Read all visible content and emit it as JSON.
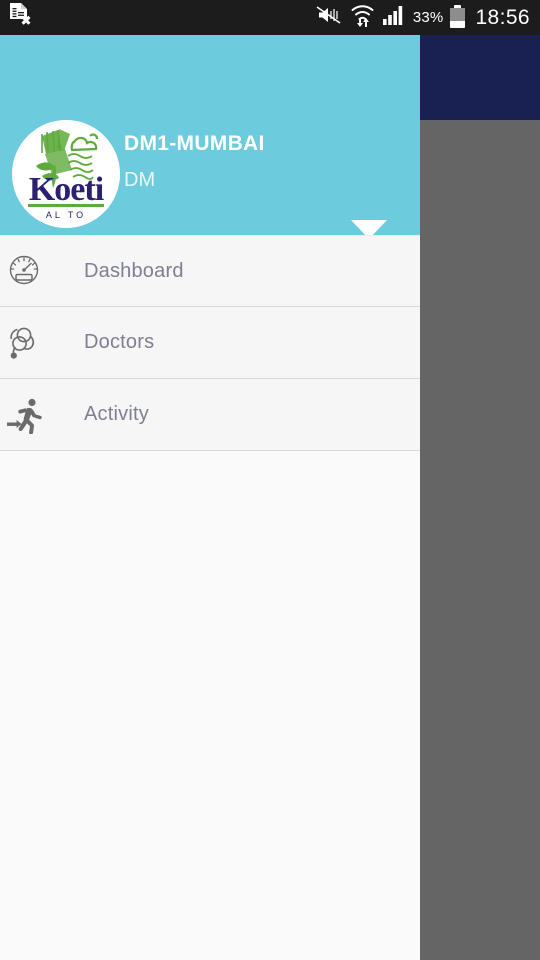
{
  "status_bar": {
    "left_icons": [
      {
        "name": "document-error-icon",
        "glyph": "document-x"
      }
    ],
    "right_icons": [
      {
        "name": "mute-icon",
        "glyph": "speaker-muted"
      },
      {
        "name": "wifi-transfer-icon",
        "glyph": "wifi-arrows"
      },
      {
        "name": "signal-icon",
        "glyph": "signal-bars"
      }
    ],
    "battery_percent": "33%",
    "clock": "18:56"
  },
  "drawer": {
    "header": {
      "title": "DM1-MUMBAI",
      "subtitle": "DM",
      "logo": {
        "name": "koeti-logo",
        "wordmark": "Koeti",
        "tagline": "AL TO",
        "emblem_color": "#5eaa3c",
        "wordmark_color": "#2a2170"
      },
      "dropdown_icon": "chevron-down-icon",
      "background_color": "#6ccbdd"
    },
    "menu_items": [
      {
        "label": "Dashboard",
        "icon": "speedometer-icon"
      },
      {
        "label": "Doctors",
        "icon": "stethoscope-icon"
      },
      {
        "label": "Activity",
        "icon": "running-person-icon"
      }
    ]
  },
  "background_app": {
    "appbar_color": "#192153",
    "scrim_color": "#656565"
  }
}
